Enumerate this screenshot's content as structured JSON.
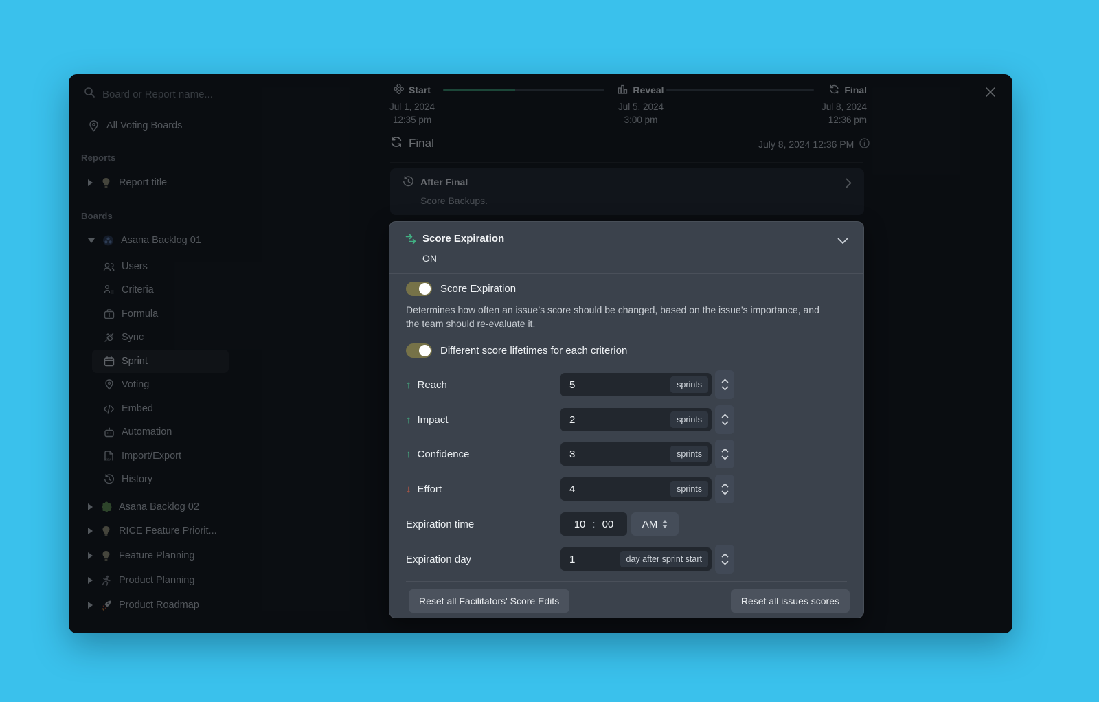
{
  "colors": {
    "desktop": "#3ac1ec",
    "panel_bg": "#3b424c",
    "accent_green": "#41b183",
    "toggle_on": "#767248",
    "effort_red": "#cd5c44"
  },
  "sidebar": {
    "search": {
      "placeholder": "Board or Report name..."
    },
    "all_boards_label": "All Voting Boards",
    "reports_section": "Reports",
    "report_item": {
      "label": "Report title"
    },
    "boards_section": "Boards",
    "board_expanded": {
      "label": "Asana Backlog 01"
    },
    "board_children": [
      {
        "label": "Users"
      },
      {
        "label": "Criteria"
      },
      {
        "label": "Formula"
      },
      {
        "label": "Sync"
      },
      {
        "label": "Sprint"
      },
      {
        "label": "Voting"
      },
      {
        "label": "Embed"
      },
      {
        "label": "Automation"
      },
      {
        "label": "Import/Export"
      },
      {
        "label": "History"
      }
    ],
    "boards": [
      {
        "label": "Asana Backlog 02"
      },
      {
        "label": "RICE Feature Priorit..."
      },
      {
        "label": "Feature Planning"
      },
      {
        "label": "Product Planning"
      },
      {
        "label": "Product Roadmap"
      }
    ]
  },
  "timeline": {
    "milestones": [
      {
        "label": "Start",
        "date": "Jul 1, 2024",
        "time": "12:35 pm"
      },
      {
        "label": "Reveal",
        "date": "Jul 5, 2024",
        "time": "3:00 pm"
      },
      {
        "label": "Final",
        "date": "Jul 8, 2024",
        "time": "12:36 pm"
      }
    ]
  },
  "final_section": {
    "title": "Final",
    "datetime": "July 8, 2024 12:36 PM"
  },
  "after_final": {
    "title": "After Final",
    "subtitle": "Score Backups."
  },
  "panel": {
    "title": "Score Expiration",
    "status": "ON",
    "toggle1_label": "Score Expiration",
    "description": "Determines how often an issue’s score should be changed, based on the issue’s importance, and the team should re-evaluate it.",
    "toggle2_label": "Different score lifetimes for each criterion",
    "criteria": [
      {
        "label": "Reach",
        "arrow": "↑",
        "value": "5",
        "unit": "sprints"
      },
      {
        "label": "Impact",
        "arrow": "↑",
        "value": "2",
        "unit": "sprints"
      },
      {
        "label": "Confidence",
        "arrow": "↑",
        "value": "3",
        "unit": "sprints"
      },
      {
        "label": "Effort",
        "arrow": "↓",
        "value": "4",
        "unit": "sprints"
      }
    ],
    "expiration_time": {
      "label": "Expiration time",
      "hour": "10",
      "colon": ":",
      "minute": "00",
      "meridiem": "AM"
    },
    "expiration_day": {
      "label": "Expiration day",
      "value": "1",
      "unit": "day after sprint start"
    },
    "buttons": {
      "reset_edits": "Reset all Facilitators' Score Edits",
      "reset_scores": "Reset all issues scores"
    }
  }
}
